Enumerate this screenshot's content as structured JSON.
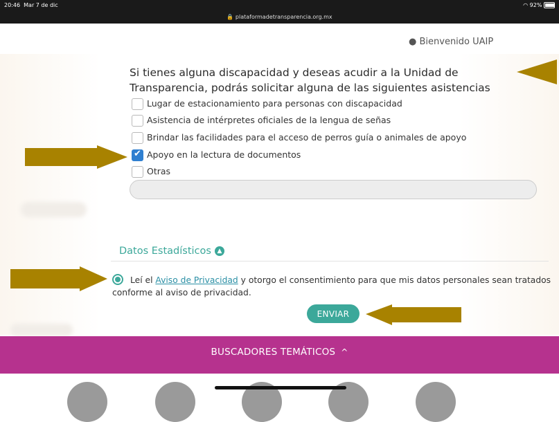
{
  "status_bar": {
    "time": "20:46",
    "date": "Mar 7 de dic",
    "url": "plataformadetransparencia.org.mx",
    "battery": "92%",
    "battery_level": 0.92
  },
  "header": {
    "welcome": "Bienvenido UAIP",
    "user_icon": "user-circle-icon"
  },
  "assistance": {
    "question": "Si tienes alguna discapacidad y deseas acudir a la Unidad de Transparencia, podrás solicitar alguna de las siguientes asistencias",
    "options": [
      {
        "label": "Lugar de estacionamiento para personas con discapacidad",
        "checked": false
      },
      {
        "label": "Asistencia de intérpretes oficiales de la lengua de señas",
        "checked": false
      },
      {
        "label": "Brindar las facilidades para el acceso de perros guía o animales de apoyo",
        "checked": false
      },
      {
        "label": "Apoyo en la lectura de documentos",
        "checked": true
      },
      {
        "label": "Otras",
        "checked": false
      }
    ],
    "other_value": ""
  },
  "stats": {
    "title": "Datos Estadísticos",
    "icon": "chevron-up-circle-icon"
  },
  "consent": {
    "prefix": "Leí el ",
    "link": "Aviso de Privacidad",
    "suffix": " y otorgo el consentimiento para que mis datos personales sean tratados",
    "line2": "conforme al aviso de privacidad.",
    "checked": true
  },
  "send_button": "ENVIAR",
  "footer": {
    "label": "BUSCADORES TEMÁTICOS",
    "icon": "chevron-up-icon",
    "up_glyph": "^"
  },
  "colors": {
    "accent": "#3ca89a",
    "footer_bg": "#b6328e",
    "checkbox_checked": "#2f7fd0",
    "annotation_arrow": "#a88200"
  }
}
